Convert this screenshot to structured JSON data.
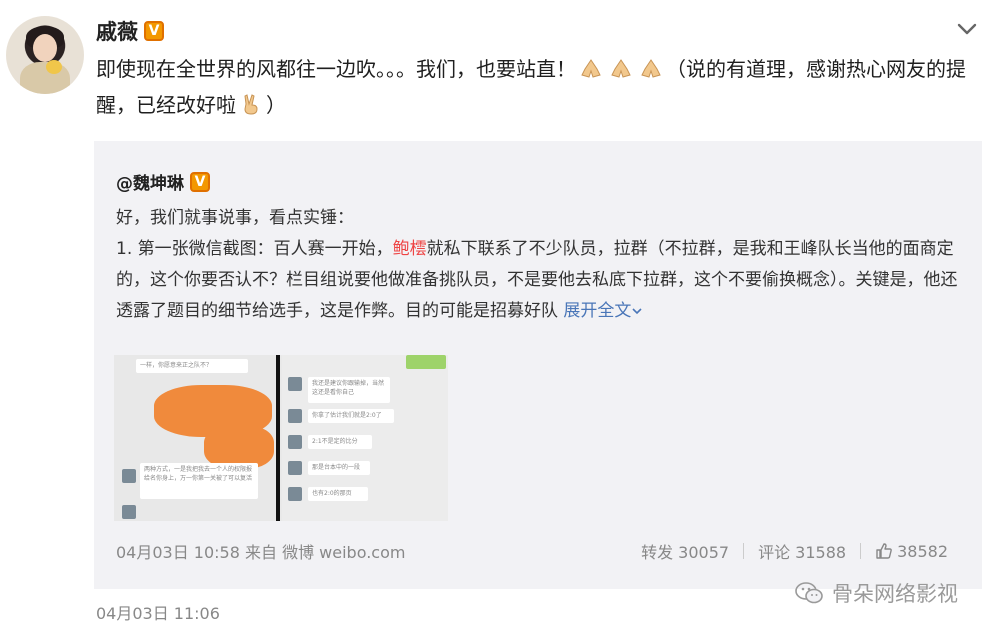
{
  "post": {
    "username": "戚薇",
    "verified_badge": "V",
    "text_main": "即使现在全世界的风都往一边吹。。。我们，也要站直！",
    "text_tail": "（说的有道理，感谢热心网友的提醒，已经改好啦",
    "text_end": "）",
    "emoji": [
      "pray-icon",
      "pray-icon",
      "pray-icon",
      "victory-hand-icon"
    ],
    "time": "04月03日 11:06"
  },
  "repost": {
    "username": "@魏坤琳",
    "verified_badge": "V",
    "line1": "好，我们就事说事，看点实锤：",
    "line2_a": "1. 第一张微信截图：百人赛一开始，",
    "line2_red": "鲍橒",
    "line2_b": "就私下联系了不少队员，拉群（不拉群，是我和王峰队长当他的面商定的，这个你要否认不？栏目组说要他做准备挑队员，不是要他去私底下拉群，这个不要偷换概念）。关键是，他还透露了题目的细节给选手，这是作弊。目的可能是招募好队",
    "expand": "展开全文",
    "meta": "04月03日 10:58 来自 微博 weibo.com",
    "repost_label": "转发 30057",
    "comment_label": "评论 31588",
    "like_count": "38582",
    "chat_left": [
      "一样，你愿意来正之队不？",
      "两种方式，一是我把我去一个人的权限报给名你身上，万一你第一关被了可以复活"
    ],
    "chat_right": [
      "我还是建议你跟输掉，当然这还是看你自己",
      "你拿了估计我们就是2:0了",
      "2:1不是定的比分",
      "那是台本中的一段",
      "也有2:0的那页"
    ]
  },
  "watermark": {
    "text": "骨朵网络影视",
    "icon": "wechat-icon"
  },
  "colors": {
    "accent_link": "#4a76b8",
    "highlight_red": "#e44444",
    "badge_orange": "#f39800",
    "repost_bg": "#f2f2f5"
  }
}
